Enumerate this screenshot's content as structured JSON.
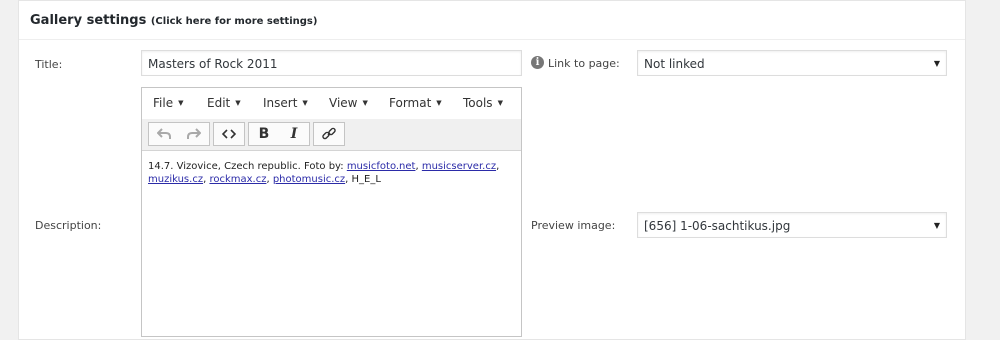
{
  "panel": {
    "title": "Gallery settings",
    "subtitle": "(Click here for more settings)"
  },
  "title_field": {
    "label": "Title:",
    "value": "Masters of Rock 2011"
  },
  "link_field": {
    "label": "Link to page:",
    "value": "Not linked",
    "icon": "info-icon"
  },
  "description_field": {
    "label": "Description:"
  },
  "preview_field": {
    "label": "Preview image:",
    "value": "[656] 1-06-sachtikus.jpg"
  },
  "editor": {
    "menu": [
      "File",
      "Edit",
      "Insert",
      "View",
      "Format",
      "Tools"
    ],
    "toolbar": {
      "undo": "undo-icon",
      "redo": "redo-icon",
      "source": "code-icon",
      "bold": "B",
      "italic": "I",
      "link": "link-icon"
    },
    "content": {
      "prefix": "14.7. Vizovice, Czech republic. Foto by: ",
      "links": [
        "musicfoto.net",
        "musicserver.cz",
        "muzikus.cz",
        "rockmax.cz",
        "photomusic.cz"
      ],
      "suffix": ", H_E_L"
    }
  },
  "colors": {
    "background": "#f1f1f1",
    "panel": "#ffffff",
    "link": "#2b2ba8"
  }
}
